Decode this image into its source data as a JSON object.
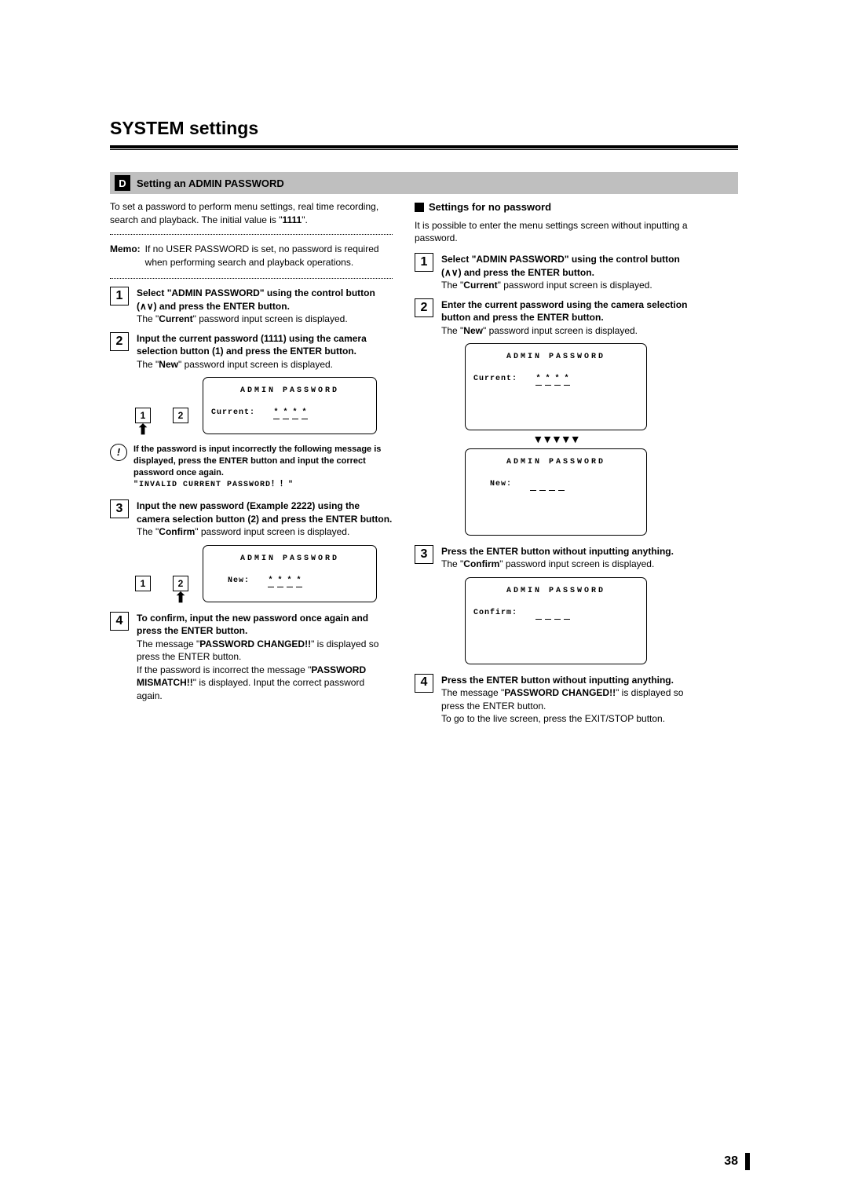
{
  "title": "SYSTEM settings",
  "section": {
    "letter": "D",
    "label": "Setting an ADMIN PASSWORD"
  },
  "left": {
    "intro_a": "To set a password to perform menu settings, real time recording, search and playback. The initial value is \"",
    "intro_b": "1111",
    "intro_c": "\".",
    "memo_label": "Memo:",
    "memo": "If no USER PASSWORD is set, no password is required when performing search and playback operations.",
    "s1_head_a": "Select \"ADMIN PASSWORD\" using the control button (",
    "s1_head_b": ") and press the ENTER button.",
    "s1_body_a": "The \"",
    "s1_body_b": "Current",
    "s1_body_c": "\" password input screen is displayed.",
    "s2_head": "Input the current password (1111) using the camera selection button (1) and press the ENTER button.",
    "s2_body_a": "The \"",
    "s2_body_b": "New",
    "s2_body_c": "\" password input screen is displayed.",
    "cam1": "1",
    "cam2": "2",
    "scr1_title": "ADMIN PASSWORD",
    "scr1_label": "Current:",
    "note_a": "If the password is input incorrectly the following message is displayed, press the ENTER button and input the correct password once again.",
    "note_b": "\"INVALID CURRENT PASSWORD！！\"",
    "s3_head": "Input the new password (Example 2222) using the camera selection button (2) and press the ENTER button.",
    "s3_body_a": "The \"",
    "s3_body_b": "Confirm",
    "s3_body_c": "\" password input screen is displayed.",
    "scr2_label": "New:",
    "s4_head": "To confirm, input the new password once again and press the ENTER button.",
    "s4_body_a": "The message \"",
    "s4_body_b": "PASSWORD CHANGED!!",
    "s4_body_c": "\" is displayed so press the ENTER button.",
    "s4_body_d": "If the password is incorrect the message \"",
    "s4_body_e": "PASSWORD MISMATCH!!",
    "s4_body_f": "\" is displayed. Input the correct password again."
  },
  "right": {
    "subhead": "Settings for no password",
    "intro": "It is possible to enter the menu settings screen without inputting a password.",
    "s1_head_a": "Select \"ADMIN PASSWORD\" using the control button (",
    "s1_head_b": ") and press the ENTER button.",
    "s1_body_a": "The \"",
    "s1_body_b": "Current",
    "s1_body_c": "\" password input screen is displayed.",
    "s2_head": "Enter the current password using the camera selection button and press the ENTER button.",
    "s2_body_a": "The \"",
    "s2_body_b": "New",
    "s2_body_c": "\" password input screen is displayed.",
    "scrA_title": "ADMIN PASSWORD",
    "scrA_label": "Current:",
    "scrB_label": "New:",
    "s3_head": "Press the ENTER button without inputting anything.",
    "s3_body_a": "The \"",
    "s3_body_b": "Confirm",
    "s3_body_c": "\" password input screen is displayed.",
    "scrC_label": "Confirm:",
    "s4_head": "Press the ENTER button without inputting anything.",
    "s4_body_a": "The message \"",
    "s4_body_b": "PASSWORD CHANGED!!",
    "s4_body_c": "\" is displayed so press the ENTER button.",
    "s4_body_d": "To go to the live screen, press the EXIT/STOP button."
  },
  "pagenum": "38"
}
